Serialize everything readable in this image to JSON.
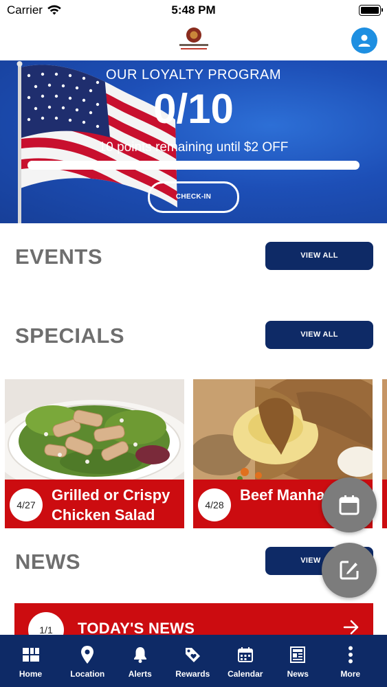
{
  "status_bar": {
    "carrier": "Carrier",
    "time": "5:48 PM"
  },
  "header": {
    "logo_alt": "Ralph D. Lott American Legion Post"
  },
  "loyalty": {
    "title": "OUR LOYALTY PROGRAM",
    "score": "0/10",
    "remaining": "10 points remaining until $2 OFF",
    "progress_fraction": 0.0,
    "checkin_label": "CHECK-IN"
  },
  "events": {
    "title": "EVENTS",
    "view_all_label": "VIEW ALL"
  },
  "specials": {
    "title": "SPECIALS",
    "view_all_label": "VIEW ALL",
    "items": [
      {
        "date": "4/27",
        "name": "Grilled or Crispy Chicken Salad"
      },
      {
        "date": "4/28",
        "name": "Beef Manhattan"
      }
    ]
  },
  "news": {
    "title": "NEWS",
    "view_all_label": "VIEW ALL",
    "banner_count": "1/1",
    "banner_title": "TODAY'S NEWS"
  },
  "nav": {
    "items": [
      {
        "label": "Home",
        "icon": "home-grid-icon"
      },
      {
        "label": "Location",
        "icon": "location-pin-icon"
      },
      {
        "label": "Alerts",
        "icon": "bell-icon"
      },
      {
        "label": "Rewards",
        "icon": "tag-heart-icon"
      },
      {
        "label": "Calendar",
        "icon": "calendar-icon"
      },
      {
        "label": "News",
        "icon": "newspaper-icon"
      },
      {
        "label": "More",
        "icon": "more-vertical-icon"
      }
    ]
  },
  "colors": {
    "brand_navy": "#0e2a66",
    "accent_red": "#cc0c10",
    "profile_blue": "#1e8fe1",
    "fab_gray": "#7c7c7c"
  }
}
